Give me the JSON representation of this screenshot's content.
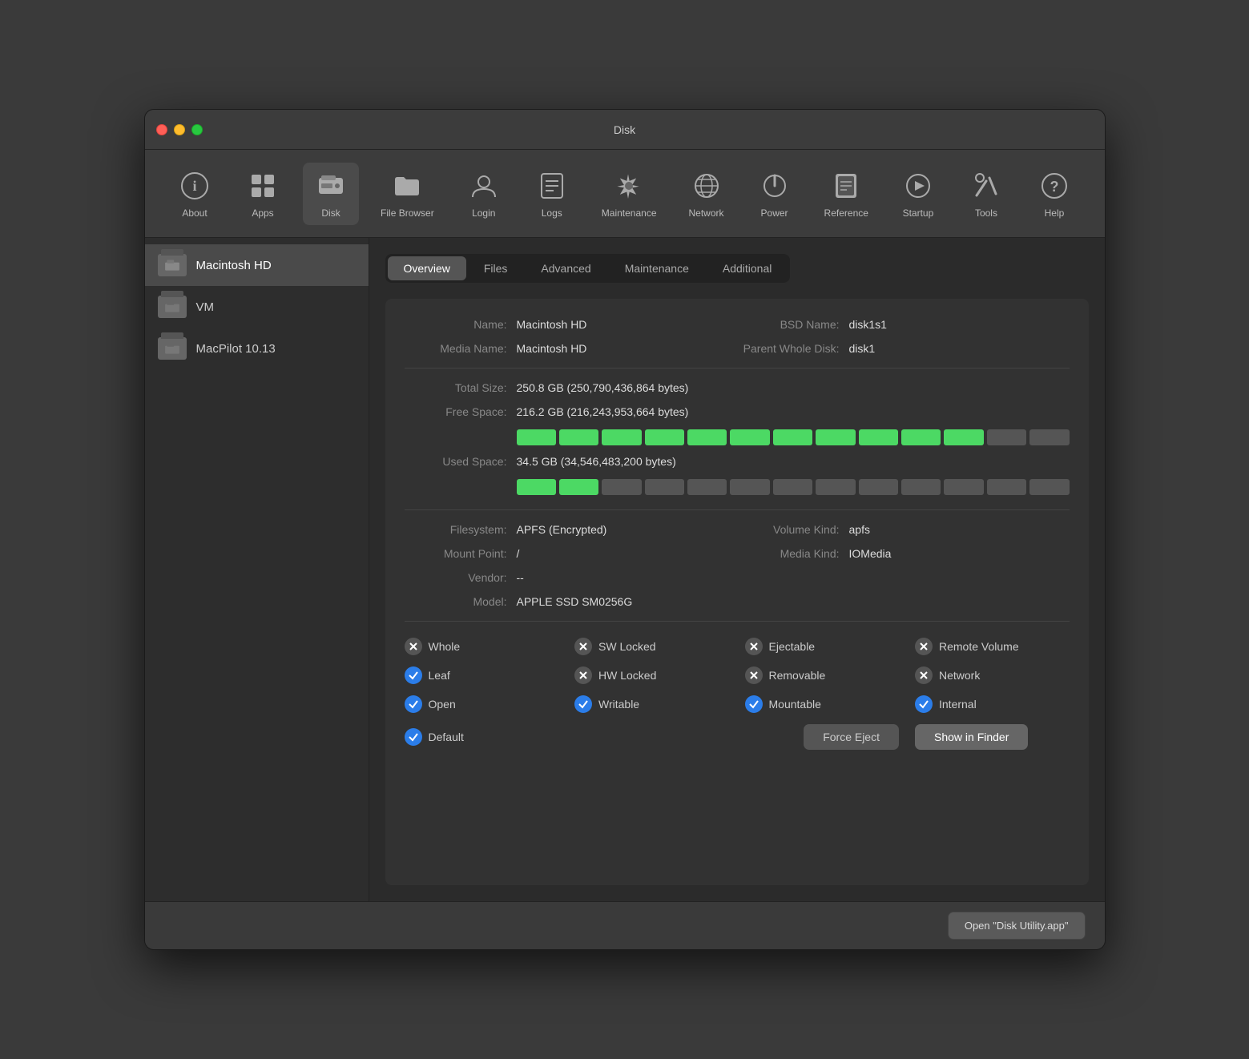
{
  "window": {
    "title": "Disk"
  },
  "toolbar": {
    "items": [
      {
        "id": "about",
        "label": "About",
        "icon": "info"
      },
      {
        "id": "apps",
        "label": "Apps",
        "icon": "apps"
      },
      {
        "id": "disk",
        "label": "Disk",
        "icon": "disk"
      },
      {
        "id": "file-browser",
        "label": "File Browser",
        "icon": "folder"
      },
      {
        "id": "login",
        "label": "Login",
        "icon": "login"
      },
      {
        "id": "logs",
        "label": "Logs",
        "icon": "logs"
      },
      {
        "id": "maintenance",
        "label": "Maintenance",
        "icon": "wrench"
      },
      {
        "id": "network",
        "label": "Network",
        "icon": "network"
      },
      {
        "id": "power",
        "label": "Power",
        "icon": "power"
      },
      {
        "id": "reference",
        "label": "Reference",
        "icon": "reference"
      },
      {
        "id": "startup",
        "label": "Startup",
        "icon": "startup"
      },
      {
        "id": "tools",
        "label": "Tools",
        "icon": "tools"
      },
      {
        "id": "help",
        "label": "Help",
        "icon": "help"
      }
    ]
  },
  "sidebar": {
    "items": [
      {
        "id": "macintosh-hd",
        "label": "Macintosh HD",
        "selected": true
      },
      {
        "id": "vm",
        "label": "VM",
        "selected": false
      },
      {
        "id": "macpilot",
        "label": "MacPilot 10.13",
        "selected": false
      }
    ]
  },
  "tabs": [
    {
      "id": "overview",
      "label": "Overview",
      "active": true
    },
    {
      "id": "files",
      "label": "Files",
      "active": false
    },
    {
      "id": "advanced",
      "label": "Advanced",
      "active": false
    },
    {
      "id": "maintenance",
      "label": "Maintenance",
      "active": false
    },
    {
      "id": "additional",
      "label": "Additional",
      "active": false
    }
  ],
  "overview": {
    "name_label": "Name:",
    "name_value": "Macintosh HD",
    "bsd_name_label": "BSD Name:",
    "bsd_name_value": "disk1s1",
    "media_name_label": "Media Name:",
    "media_name_value": "Macintosh HD",
    "parent_whole_disk_label": "Parent Whole Disk:",
    "parent_whole_disk_value": "disk1",
    "total_size_label": "Total Size:",
    "total_size_value": "250.8 GB (250,790,436,864 bytes)",
    "free_space_label": "Free Space:",
    "free_space_value": "216.2 GB (216,243,953,664 bytes)",
    "free_space_pct": 86,
    "used_space_label": "Used Space:",
    "used_space_value": "34.5 GB (34,546,483,200 bytes)",
    "used_space_pct": 14,
    "filesystem_label": "Filesystem:",
    "filesystem_value": "APFS (Encrypted)",
    "volume_kind_label": "Volume Kind:",
    "volume_kind_value": "apfs",
    "mount_point_label": "Mount Point:",
    "mount_point_value": "/",
    "media_kind_label": "Media Kind:",
    "media_kind_value": "IOMedia",
    "vendor_label": "Vendor:",
    "vendor_value": "--",
    "model_label": "Model:",
    "model_value": "APPLE SSD SM0256G",
    "checkboxes": [
      {
        "id": "whole",
        "label": "Whole",
        "checked": false
      },
      {
        "id": "sw-locked",
        "label": "SW Locked",
        "checked": false
      },
      {
        "id": "ejectable",
        "label": "Ejectable",
        "checked": false
      },
      {
        "id": "remote-volume",
        "label": "Remote Volume",
        "checked": false
      },
      {
        "id": "leaf",
        "label": "Leaf",
        "checked": true
      },
      {
        "id": "hw-locked",
        "label": "HW Locked",
        "checked": false
      },
      {
        "id": "removable",
        "label": "Removable",
        "checked": false
      },
      {
        "id": "network",
        "label": "Network",
        "checked": false
      },
      {
        "id": "open",
        "label": "Open",
        "checked": true
      },
      {
        "id": "writable",
        "label": "Writable",
        "checked": true
      },
      {
        "id": "mountable",
        "label": "Mountable",
        "checked": true
      },
      {
        "id": "internal",
        "label": "Internal",
        "checked": true
      },
      {
        "id": "default",
        "label": "Default",
        "checked": true
      }
    ],
    "force_eject_label": "Force Eject",
    "show_in_finder_label": "Show in Finder"
  },
  "bottom_bar": {
    "open_app_label": "Open \"Disk Utility.app\""
  }
}
